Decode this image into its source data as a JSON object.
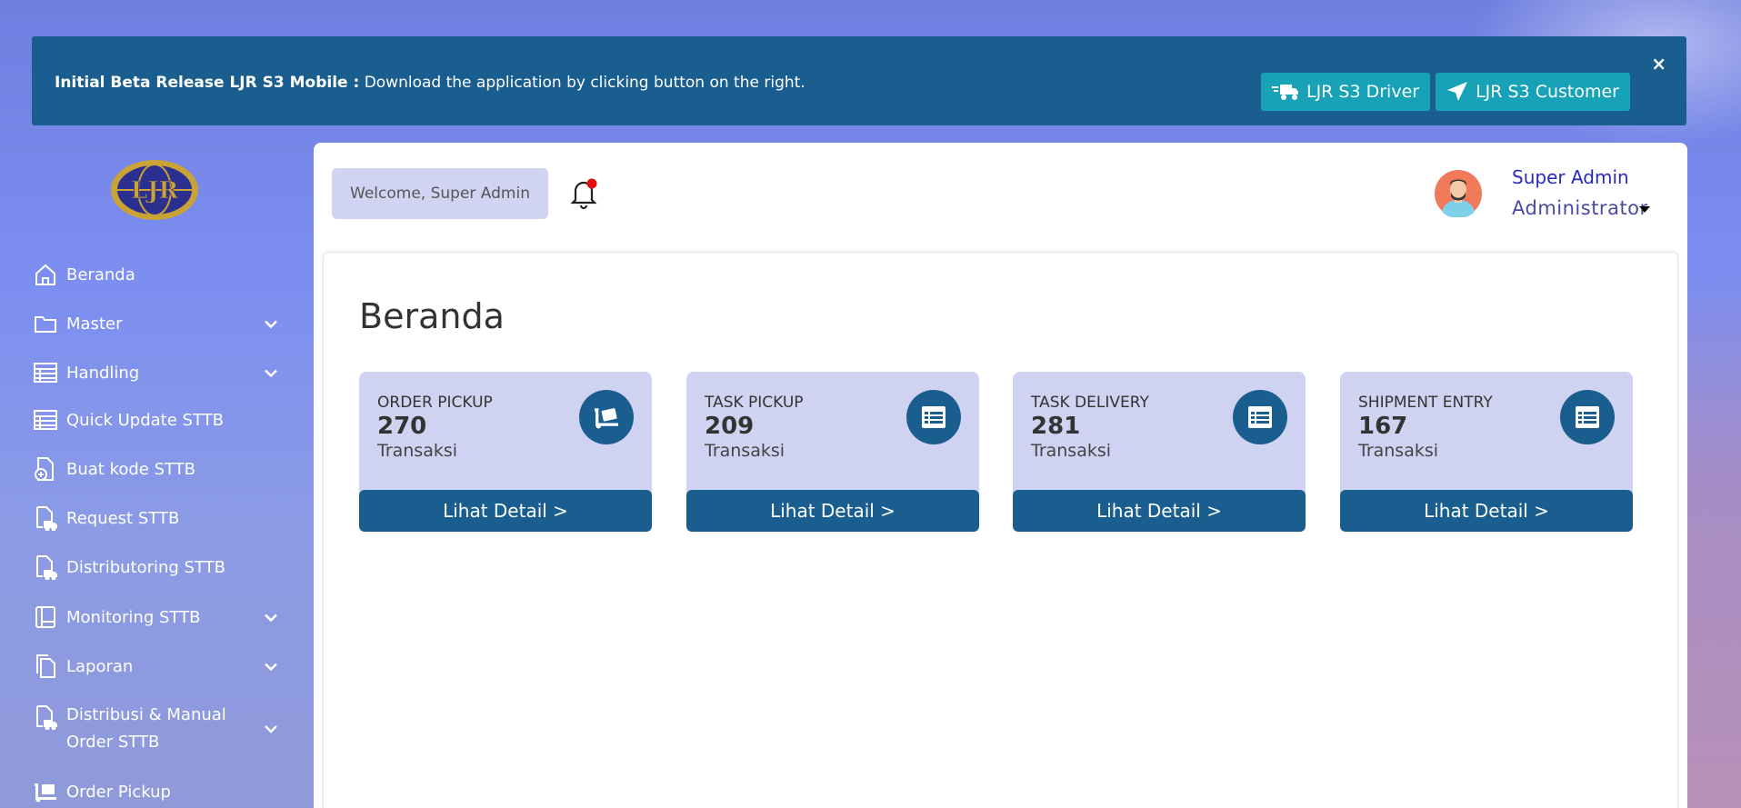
{
  "banner": {
    "title": "Initial Beta Release LJR S3 Mobile :",
    "message": "Download the application by clicking button on the right.",
    "driver_button": "LJR S3 Driver",
    "customer_button": "LJR S3 Customer",
    "close": "×"
  },
  "sidebar": {
    "logo_text": "LJR",
    "items": [
      {
        "label": "Beranda",
        "icon": "home-icon"
      },
      {
        "label": "Master",
        "icon": "folder-icon"
      },
      {
        "label": "Handling",
        "icon": "table-icon"
      },
      {
        "label": "Quick Update STTB",
        "icon": "table-icon"
      },
      {
        "label": "Buat kode STTB",
        "icon": "file-add-icon"
      },
      {
        "label": "Request STTB",
        "icon": "file-truck-icon"
      },
      {
        "label": "Distributoring STTB",
        "icon": "file-truck-icon"
      },
      {
        "label": "Monitoring STTB",
        "icon": "book-icon"
      },
      {
        "label": "Laporan",
        "icon": "files-icon"
      },
      {
        "label": "Distribusi & Manual",
        "label2": "Order STTB",
        "icon": "file-truck-icon"
      },
      {
        "label": "Order Pickup",
        "icon": "dolly-icon"
      }
    ]
  },
  "header": {
    "welcome": "Welcome, Super Admin",
    "user_name": "Super Admin",
    "user_role": "Administrator"
  },
  "page": {
    "title": "Beranda"
  },
  "stats": [
    {
      "label": "ORDER PICKUP",
      "value": "270",
      "unit": "Transaksi",
      "button": "Lihat Detail >",
      "icon": "dolly-icon"
    },
    {
      "label": "TASK PICKUP",
      "value": "209",
      "unit": "Transaksi",
      "button": "Lihat Detail >",
      "icon": "table-icon"
    },
    {
      "label": "TASK DELIVERY",
      "value": "281",
      "unit": "Transaksi",
      "button": "Lihat Detail >",
      "icon": "table-icon"
    },
    {
      "label": "SHIPMENT ENTRY",
      "value": "167",
      "unit": "Transaksi",
      "button": "Lihat Detail >",
      "icon": "table-icon"
    }
  ],
  "colors": {
    "primary": "#1a5e8f",
    "accent": "#17a2b8",
    "card_bg": "#d0d2f2"
  }
}
